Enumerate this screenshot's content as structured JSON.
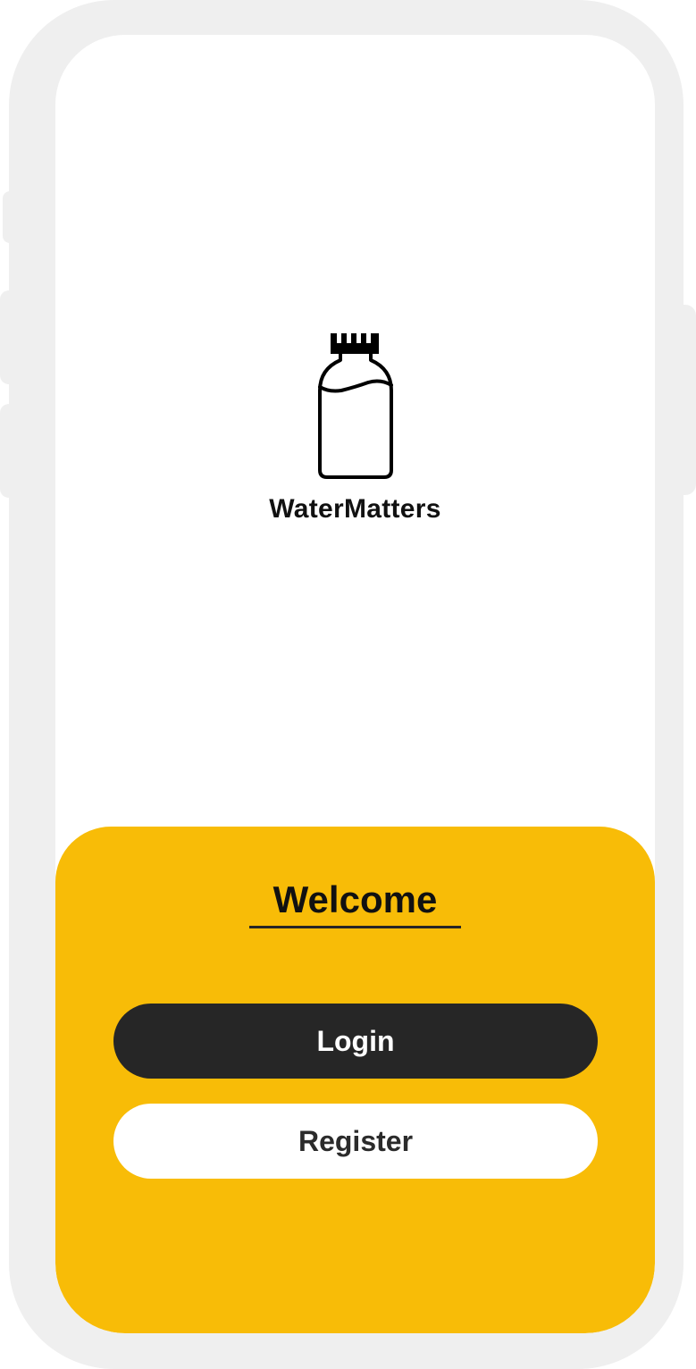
{
  "app": {
    "name": "WaterMatters",
    "logo_icon": "water-bottle-icon"
  },
  "welcome": {
    "title": "Welcome"
  },
  "actions": {
    "login_label": "Login",
    "register_label": "Register"
  },
  "colors": {
    "accent": "#f8bc07",
    "primary_button": "#262626",
    "secondary_button": "#ffffff",
    "frame": "#efefef"
  }
}
